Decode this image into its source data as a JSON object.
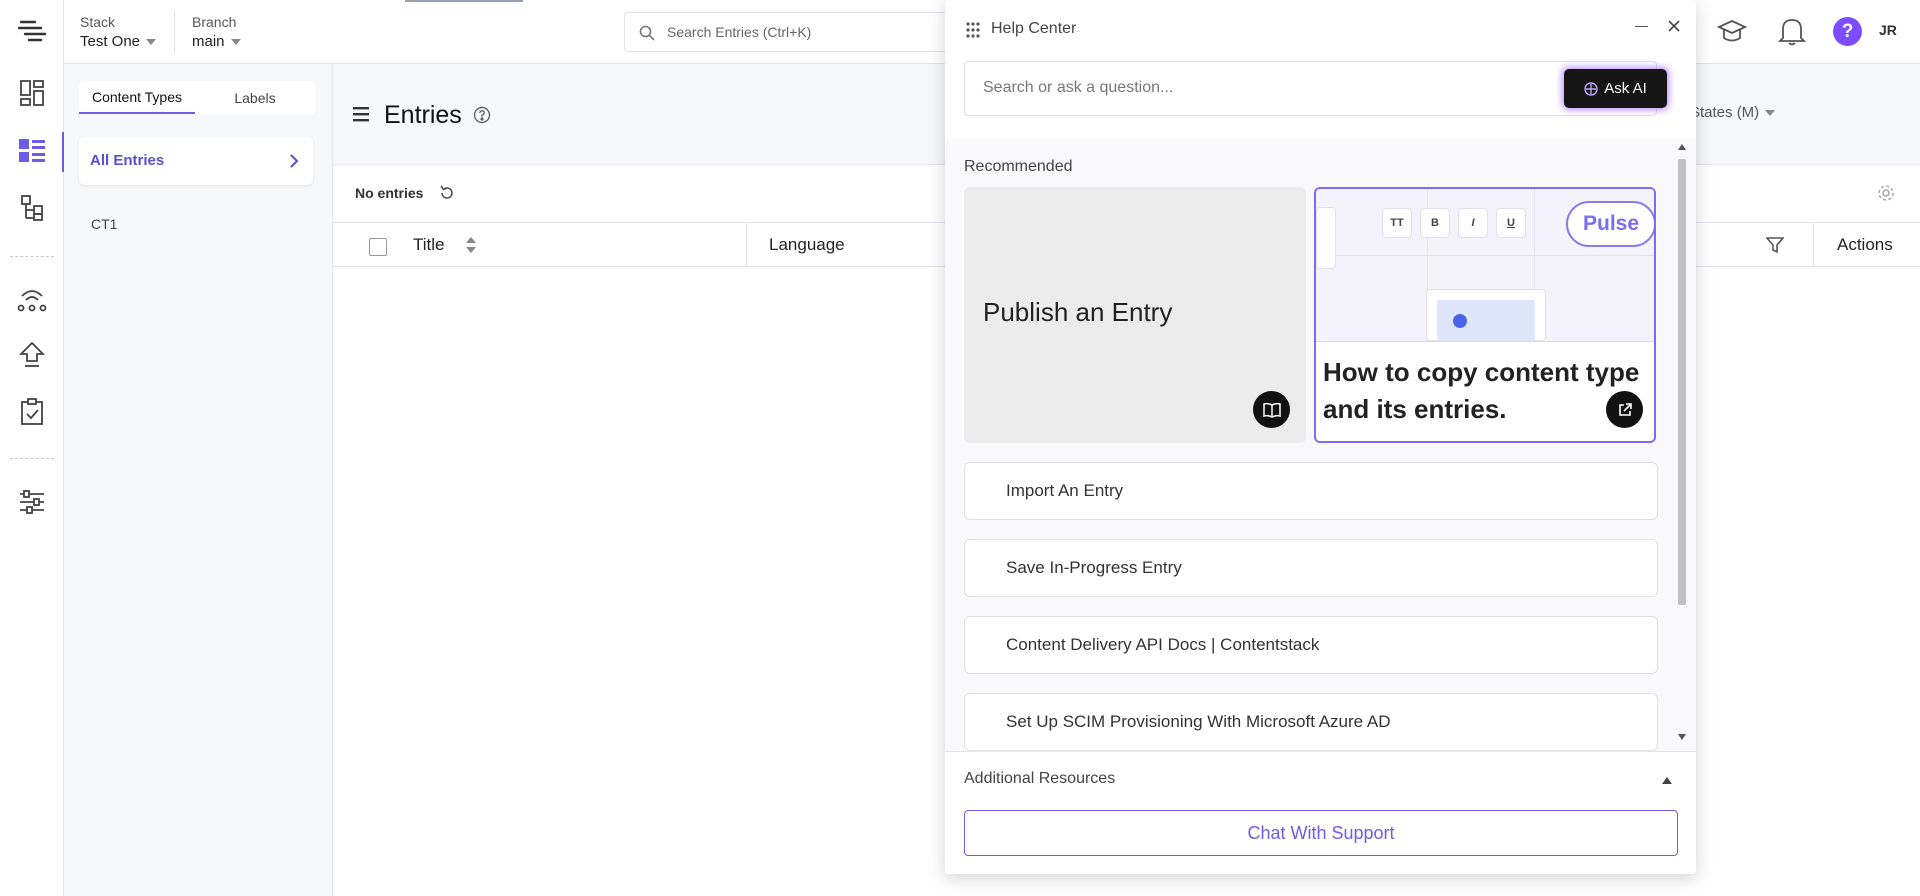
{
  "header": {
    "stack_label": "Stack",
    "stack_value": "Test One",
    "branch_label": "Branch",
    "branch_value": "main",
    "search_placeholder": "Search Entries (Ctrl+K)",
    "user_initials": "JR",
    "help_glyph": "?"
  },
  "sidebar": {
    "tabs": [
      {
        "label": "Content Types",
        "active": true
      },
      {
        "label": "Labels",
        "active": false
      }
    ],
    "all_entries_label": "All Entries",
    "content_types": [
      "CT1"
    ]
  },
  "main": {
    "title": "Entries",
    "workflow_filter_label": "States (M)",
    "no_entries_label": "No entries",
    "columns": [
      "Title",
      "Language",
      "Actions"
    ]
  },
  "help_center": {
    "title": "Help Center",
    "search_placeholder": "Search or ask a question...",
    "ask_ai_label": "Ask AI",
    "recommended_label": "Recommended",
    "featured": [
      {
        "title": "Publish an Entry",
        "icon": "book-icon"
      },
      {
        "title": "How to copy content type and its entries.",
        "badge": "Pulse",
        "icon": "external-link-icon",
        "toolbar": [
          "TT",
          "B",
          "I",
          "U"
        ]
      }
    ],
    "links": [
      "Import An Entry",
      "Save In-Progress Entry",
      "Content Delivery API Docs | Contentstack",
      "Set Up SCIM Provisioning With Microsoft Azure AD"
    ],
    "additional_resources_label": "Additional Resources",
    "chat_support_label": "Chat With Support"
  },
  "colors": {
    "accent": "#6c5ce7",
    "brand_purple": "#7c4dff",
    "dark": "#111111"
  }
}
